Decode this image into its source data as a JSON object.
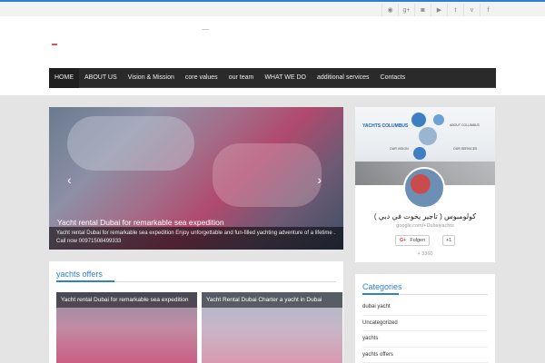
{
  "social_icons": [
    "rss-icon",
    "google-plus-icon",
    "instagram-icon",
    "youtube-icon",
    "twitter-icon",
    "vimeo-icon",
    "facebook-icon"
  ],
  "social_glyphs": [
    "◉",
    "g+",
    "◙",
    "▶",
    "t",
    "v",
    "f"
  ],
  "nav": {
    "items": [
      "HOME",
      "ABOUT US",
      "Vision & Mission",
      "core values",
      "our team",
      "WHAT WE DO",
      "additional services",
      "Contacts"
    ]
  },
  "slider": {
    "title": "Yacht rental Dubai for remarkable sea expedition",
    "caption": "Yacht rental Dubai for remarkable sea expedition Enjoy unforgettable and fun-filled yachting adventure of a lifetime . Call now 00971508499333",
    "prev": "‹",
    "next": "›"
  },
  "offers": {
    "heading": "yachts offers",
    "cards": [
      {
        "title": "Yacht rental Dubai for remarkable sea expedition"
      },
      {
        "title": "Yacht Rental Dubai Charter a yacht in Dubai"
      }
    ]
  },
  "gplus": {
    "banner_brand": "YACHTS COLUMBUS",
    "banner_tags": [
      "ABOUT COLUMBUS",
      "OUR VISION",
      "OUR SERVICES"
    ],
    "name": "كولومبوس ( تاجير يخوت في دبي )",
    "url": "google.com/+Dubaiyachts",
    "follow_label": "Folgen",
    "follow_icon": "G+",
    "plus_one": "+1",
    "followers": "+ 3360"
  },
  "categories": {
    "heading": "Categories",
    "items": [
      "dubai yacht",
      "Uncategorized",
      "yachts",
      "yachts offers"
    ]
  },
  "colors": {
    "accent": "#2f7fd3",
    "nav_bg": "#2a2a2a"
  }
}
